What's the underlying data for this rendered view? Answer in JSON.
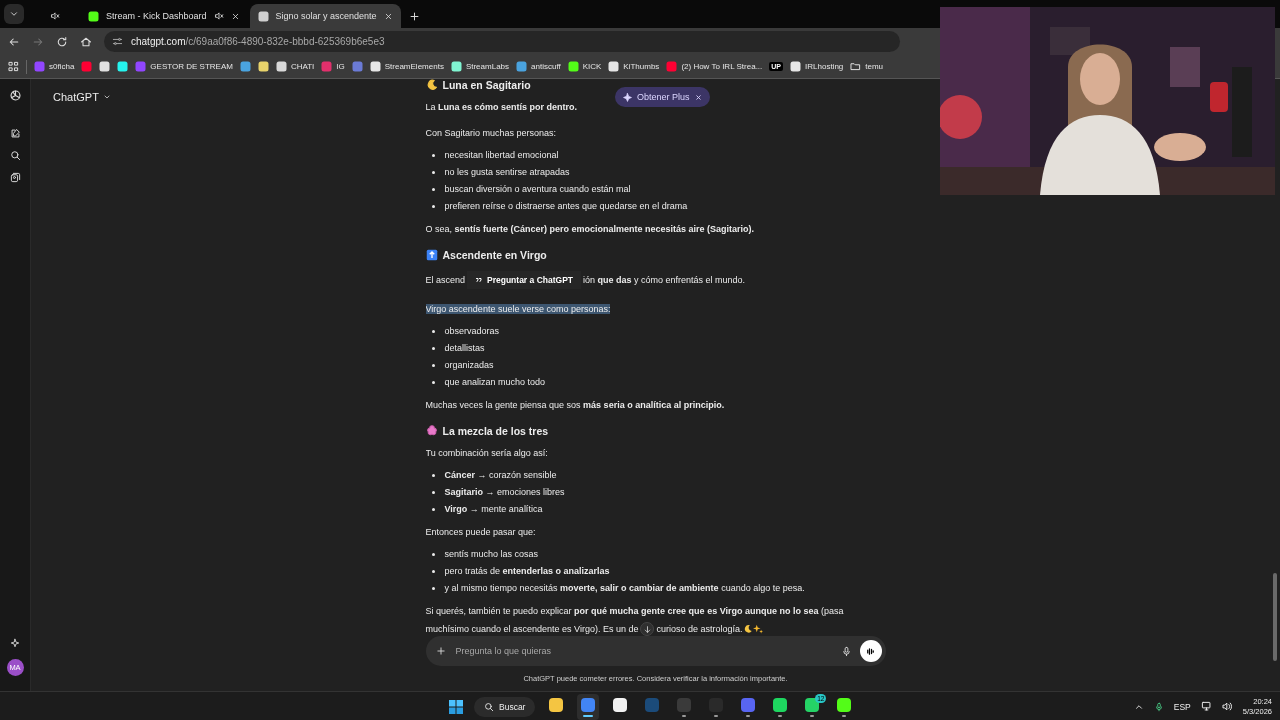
{
  "tab_strip": {
    "tabs": [
      {
        "kind": "pinned",
        "muted": true,
        "selected": false
      },
      {
        "kind": "normal",
        "title": "Stream - Kick Dashboard",
        "muted": true,
        "selected": false,
        "color": "#53fc18"
      },
      {
        "kind": "normal",
        "title": "Signo solar y ascendente",
        "muted": false,
        "selected": true,
        "color": "#d0d0d0"
      }
    ]
  },
  "address_bar": {
    "host": "chatgpt.com",
    "path": "/c/69aa0f86-4890-832e-bbbd-625369b6e5e3"
  },
  "bookmarks": [
    {
      "kind": "favicon",
      "label": "s0ficha",
      "color": "#9146ff"
    },
    {
      "kind": "favicon",
      "color": "#ff0033"
    },
    {
      "kind": "favicon",
      "color": "#e0e0e0"
    },
    {
      "kind": "favicon",
      "color": "#25f4ee"
    },
    {
      "kind": "favicon",
      "label": "GESTOR DE STREAM",
      "color": "#9146ff"
    },
    {
      "kind": "favicon",
      "color": "#4aa3df"
    },
    {
      "kind": "favicon",
      "color": "#e8d36b"
    },
    {
      "kind": "favicon",
      "label": "CHATI",
      "color": "#d9d9d9"
    },
    {
      "kind": "favicon",
      "label": "IG",
      "color": "#e1306c"
    },
    {
      "kind": "favicon",
      "color": "#6b7bd6"
    },
    {
      "kind": "favicon",
      "label": "StreamElements",
      "color": "#e6e6e6"
    },
    {
      "kind": "favicon",
      "label": "StreamLabs",
      "color": "#80f5d2"
    },
    {
      "kind": "favicon",
      "label": "antiscuff",
      "color": "#4aa3df"
    },
    {
      "kind": "favicon",
      "label": "KICK",
      "color": "#53fc18"
    },
    {
      "kind": "favicon",
      "label": "KiThumbs",
      "color": "#e6e6e6"
    },
    {
      "kind": "favicon",
      "label": "(2) How To IRL Strea...",
      "color": "#ff0033"
    },
    {
      "kind": "badge",
      "label": "UP"
    },
    {
      "kind": "favicon",
      "label": "IRLhosting",
      "color": "#e6e6e6"
    },
    {
      "kind": "folder",
      "label": "temu"
    }
  ],
  "app": {
    "title": "ChatGPT",
    "upgrade_pill": "Obtener Plus",
    "avatar": "MA"
  },
  "messages": [
    {
      "kind": "heading",
      "text": "Luna en Sagitario"
    },
    {
      "kind": "paragraph",
      "text": "La **Luna es cómo sentís por dentro.**",
      "highlighted": false
    },
    {
      "kind": "paragraph",
      "text": "Con Sagitario muchas personas:",
      "highlighted": false
    },
    {
      "kind": "list",
      "items": [
        "necesitan libertad emocional",
        "no les gusta sentirse atrapadas",
        "buscan diversión o aventura cuando están mal",
        "prefieren reírse o distraerse antes que quedarse en el drama"
      ]
    },
    {
      "kind": "paragraph",
      "text": "O sea, **sentís fuerte (Cáncer) pero emocionalmente necesitás aire (Sagitario).**",
      "highlighted": false
    },
    {
      "kind": "heading",
      "text": "Ascendente en Virgo"
    },
    {
      "kind": "covered",
      "before": "El ascend",
      "tooltip": "Preguntar a ChatGPT",
      "after": "ión **que das** y cómo enfrentás el mundo."
    },
    {
      "kind": "paragraph",
      "text": "Virgo ascendente suele verse como personas:",
      "highlighted": true
    },
    {
      "kind": "list",
      "items": [
        "observadoras",
        "detallistas",
        "organizadas",
        "que analizan mucho todo"
      ]
    },
    {
      "kind": "paragraph",
      "text": "Muchas veces la gente piensa que sos **más seria o analítica al principio.**",
      "highlighted": false
    },
    {
      "kind": "heading",
      "text": "La mezcla de los tres"
    },
    {
      "kind": "paragraph",
      "text": "Tu combinación sería algo así:",
      "highlighted": false
    },
    {
      "kind": "list",
      "items": [
        "**Cáncer** → corazón sensible",
        "**Sagitario** → emociones libres",
        "**Virgo** → mente analítica"
      ]
    },
    {
      "kind": "paragraph",
      "text": "Entonces puede pasar que:",
      "highlighted": false
    },
    {
      "kind": "list",
      "items": [
        "sentís mucho las cosas",
        "pero tratás de **entenderlas o analizarlas**",
        "y al mismo tiempo necesitás **moverte, salir o cambiar de ambiente** cuando algo te pesa."
      ]
    },
    {
      "kind": "split",
      "text": "Si querés, también te puedo explicar **por qué mucha gente cree que es Virgo aunque no lo sea** (pasa",
      "before": "muchísimo cuando el ascendente es Virgo). Es un de",
      "after": "curioso de astrología."
    }
  ],
  "composer": {
    "placeholder": "Pregunta lo que quieras"
  },
  "disclaimer": "ChatGPT puede cometer errores. Considera verificar la información importante.",
  "taskbar": {
    "search": "Buscar",
    "apps": [
      {
        "color": "#f4c542",
        "running": false,
        "selected": false
      },
      {
        "color": "#4285f4",
        "running": true,
        "selected": true
      },
      {
        "color": "#f2f2f2",
        "running": false,
        "selected": false
      },
      {
        "color": "#1b4b7a",
        "running": false,
        "selected": false
      },
      {
        "color": "#3a3a3a",
        "running": true,
        "selected": false
      },
      {
        "color": "#2a2a2a",
        "running": true,
        "selected": false
      },
      {
        "color": "#5865f2",
        "running": true,
        "selected": false
      },
      {
        "color": "#1ed760",
        "running": true,
        "selected": false
      },
      {
        "color": "#25d366",
        "running": true,
        "selected": false,
        "badge": "12"
      },
      {
        "color": "#53fc18",
        "running": true,
        "selected": false
      }
    ],
    "language": "ESP",
    "time": "20:24",
    "date": "5/3/2026"
  }
}
